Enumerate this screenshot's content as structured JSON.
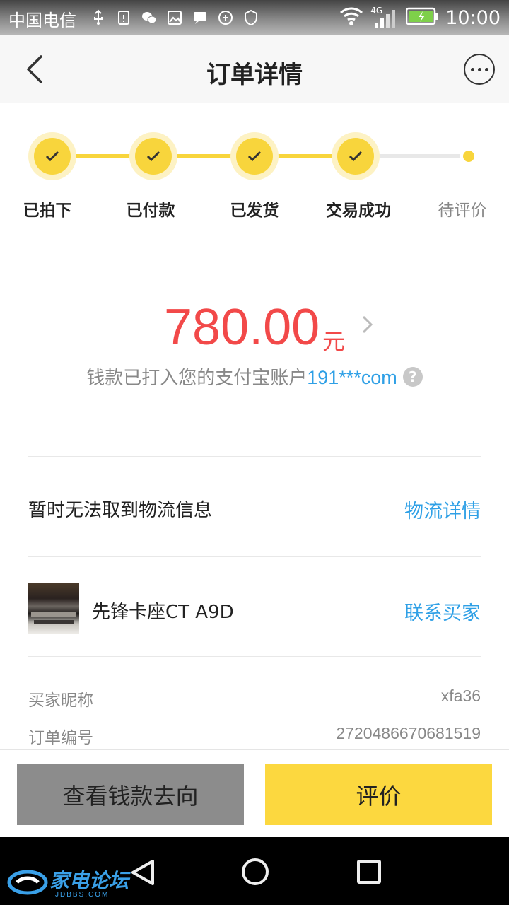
{
  "status_bar": {
    "carrier": "中国电信",
    "network": "4G",
    "time": "10:00"
  },
  "header": {
    "title": "订单详情"
  },
  "steps": [
    {
      "label": "已拍下",
      "done": true
    },
    {
      "label": "已付款",
      "done": true
    },
    {
      "label": "已发货",
      "done": true
    },
    {
      "label": "交易成功",
      "done": true
    },
    {
      "label": "待评价",
      "done": false
    }
  ],
  "amount": {
    "value": "780.00",
    "unit": "元",
    "note_prefix": "钱款已打入您的支付宝账户",
    "account": "191***com",
    "help": "?"
  },
  "logistics": {
    "text": "暂时无法取到物流信息",
    "link": "物流详情"
  },
  "product": {
    "name": "先锋卡座CT A9D",
    "link": "联系买家"
  },
  "info": {
    "buyer_label": "买家昵称",
    "buyer_value": "xfa36",
    "order_label": "订单编号",
    "order_value": "2720486670681519"
  },
  "actions": {
    "money_flow": "查看钱款去向",
    "review": "评价"
  },
  "watermark": {
    "text": "家电论坛",
    "sub": "JDBBS.COM"
  },
  "colors": {
    "accent_yellow": "#f8d53c",
    "price_red": "#f24949",
    "link_blue": "#2fa0e6"
  }
}
